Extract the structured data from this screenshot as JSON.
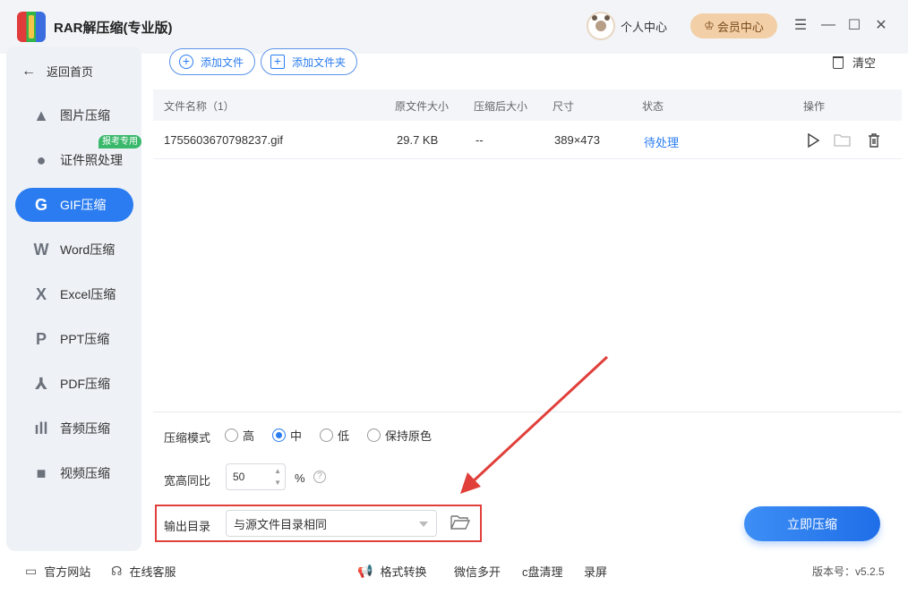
{
  "app": {
    "title": "RAR解压缩(专业版)"
  },
  "header": {
    "user_center": "个人中心",
    "vip_center": "会员中心"
  },
  "sidebar": {
    "back": "返回首页",
    "badge": "报考专用",
    "items": [
      {
        "label": "图片压缩",
        "icon": "image-icon"
      },
      {
        "label": "证件照处理",
        "icon": "id-photo-icon"
      },
      {
        "label": "GIF压缩",
        "icon": "gif-icon",
        "active": true
      },
      {
        "label": "Word压缩",
        "icon": "word-icon"
      },
      {
        "label": "Excel压缩",
        "icon": "excel-icon"
      },
      {
        "label": "PPT压缩",
        "icon": "ppt-icon"
      },
      {
        "label": "PDF压缩",
        "icon": "pdf-icon"
      },
      {
        "label": "音频压缩",
        "icon": "audio-icon"
      },
      {
        "label": "视频压缩",
        "icon": "video-icon"
      }
    ]
  },
  "toolbar": {
    "add_file": "添加文件",
    "add_folder": "添加文件夹",
    "clear": "清空"
  },
  "table": {
    "headers": [
      "文件名称（1）",
      "原文件大小",
      "压缩后大小",
      "尺寸",
      "状态",
      "操作"
    ],
    "rows": [
      {
        "name": "1755603670798237.gif",
        "size": "29.7 KB",
        "compressed": "--",
        "dimensions": "389×473",
        "status": "待处理"
      }
    ]
  },
  "settings": {
    "mode_label": "压缩模式",
    "modes": [
      "高",
      "中",
      "低",
      "保持原色"
    ],
    "selected_mode": "中",
    "ratio_label": "宽高同比",
    "ratio_value": "50",
    "ratio_unit": "%",
    "output_label": "输出目录",
    "output_value": "与源文件目录相同"
  },
  "actions": {
    "compress": "立即压缩"
  },
  "footer": {
    "website": "官方网站",
    "service": "在线客服",
    "links": [
      "格式转换",
      "微信多开",
      "c盘清理",
      "录屏"
    ],
    "version": "版本号：v5.2.5"
  },
  "colors": {
    "accent": "#2a7cf0",
    "highlight": "#e03f3a",
    "badge": "#3ab86b",
    "vip": "#f2cfa6"
  }
}
